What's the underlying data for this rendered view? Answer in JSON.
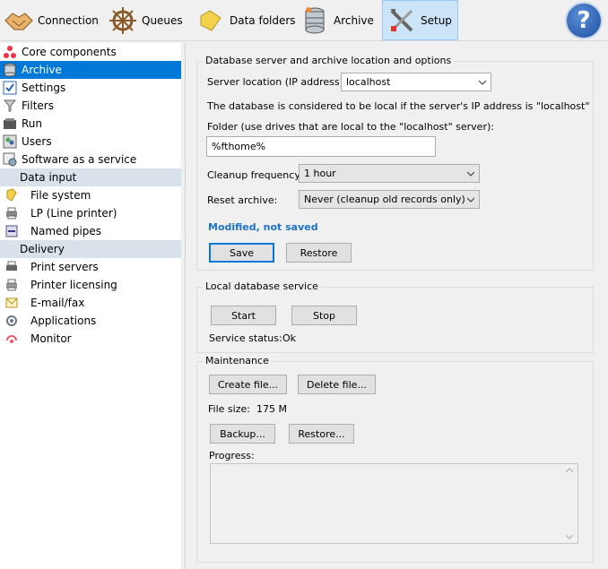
{
  "toolbar": {
    "connection": "Connection",
    "queues": "Queues",
    "data_folders": "Data folders",
    "archive": "Archive",
    "setup": "Setup"
  },
  "sidebar": {
    "items": [
      {
        "label": "Core components",
        "icon": "components-icon"
      },
      {
        "label": "Archive",
        "icon": "database-icon"
      },
      {
        "label": "Settings",
        "icon": "checklist-icon"
      },
      {
        "label": "Filters",
        "icon": "filter-icon"
      },
      {
        "label": "Run",
        "icon": "run-icon"
      },
      {
        "label": "Users",
        "icon": "users-icon"
      },
      {
        "label": "Software as a service",
        "icon": "service-icon"
      }
    ],
    "data_input_header": "Data input",
    "data_input": [
      {
        "label": "File system",
        "icon": "folder-icon"
      },
      {
        "label": "LP (Line printer)",
        "icon": "printer-icon"
      },
      {
        "label": "Named pipes",
        "icon": "pipe-icon"
      }
    ],
    "delivery_header": "Delivery",
    "delivery": [
      {
        "label": "Print servers",
        "icon": "print-server-icon"
      },
      {
        "label": "Printer licensing",
        "icon": "printer-license-icon"
      },
      {
        "label": "E-mail/fax",
        "icon": "mail-icon"
      },
      {
        "label": "Applications",
        "icon": "applications-icon"
      },
      {
        "label": "Monitor",
        "icon": "monitor-icon"
      }
    ]
  },
  "db": {
    "title": "Database server and archive location and options",
    "server_label": "Server location (IP address):",
    "server_value": "localhost",
    "note": "The database is considered to be local if the server's IP address is \"localhost\"",
    "folder_label": "Folder (use drives that are local to the \"localhost\" server):",
    "folder_value": "%fthome%",
    "cleanup_label": "Cleanup frequency:",
    "cleanup_value": "1 hour",
    "reset_label": "Reset archive:",
    "reset_value": "Never (cleanup old records only)",
    "modified": "Modified, not saved",
    "save": "Save",
    "restore": "Restore"
  },
  "local": {
    "title": "Local database service",
    "start": "Start",
    "stop": "Stop",
    "status_label": "Service status:",
    "status_value": "Ok"
  },
  "maint": {
    "title": "Maintenance",
    "create": "Create file...",
    "delete": "Delete file...",
    "size_label": "File size:",
    "size_value": "175 M",
    "backup": "Backup...",
    "restore": "Restore...",
    "progress_label": "Progress:"
  },
  "colors": {
    "selected": "#0078d7",
    "section": "#d9e1ea",
    "modified": "#1e73c8"
  }
}
